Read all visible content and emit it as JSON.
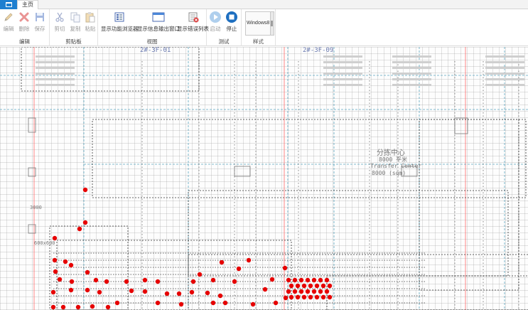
{
  "app": {
    "tab_home": "主页"
  },
  "ribbon": {
    "groups": {
      "edit": "编辑",
      "clipboard": "剪贴板",
      "view": "视图",
      "test": "测试",
      "style": "样式"
    },
    "buttons": {
      "edit": "编辑",
      "delete": "删除",
      "save": "保存",
      "cut": "剪切",
      "copy": "复制",
      "paste": "粘贴",
      "show_browser": "显示功能浏览器",
      "show_output": "显示信息输出窗口",
      "show_errors": "显示错误列表",
      "start": "启动",
      "stop": "停止"
    },
    "theme_value": "Windows8"
  },
  "canvas": {
    "labels": {
      "zone_1": "2#-3F-01",
      "zone_2": "2#-3F-09",
      "center_cn": "分拣中心",
      "center_area": "8000 平米",
      "center_en": "Transfer Center",
      "center_area2": "8000 (sqm)",
      "left_dim": "3000",
      "left_note": "600x600"
    },
    "colors": {
      "accent": "#1e7fd0",
      "dot": "#e60000",
      "grid": "#969696",
      "wall": "#333333",
      "aux_line": "#5aa5c0",
      "red_line": "#ff6a6a"
    }
  }
}
